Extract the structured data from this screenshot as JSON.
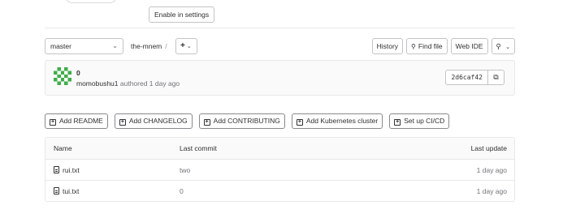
{
  "banner": {
    "enable_label": "Enable in settings"
  },
  "toolbar": {
    "branch": "master",
    "project": "the-mnem",
    "path_sep": "/",
    "add_label": "+",
    "history": "History",
    "find_file": "Find file",
    "web_ide": "Web IDE"
  },
  "commit": {
    "title": "0",
    "author": "momobushu1",
    "meta": "authored 1 day ago",
    "sha": "2d6caf42"
  },
  "actions": [
    {
      "label": "Add README"
    },
    {
      "label": "Add CHANGELOG"
    },
    {
      "label": "Add CONTRIBUTING"
    },
    {
      "label": "Add Kubernetes cluster"
    },
    {
      "label": "Set up CI/CD"
    }
  ],
  "files": {
    "headers": {
      "name": "Name",
      "last_commit": "Last commit",
      "last_update": "Last update"
    },
    "rows": [
      {
        "name": "rui.txt",
        "commit": "two",
        "update": "1 day ago"
      },
      {
        "name": "tui.txt",
        "commit": "0",
        "update": "1 day ago"
      }
    ]
  },
  "colors": {
    "avatar": "#3fae49",
    "border": "#c4c4c7"
  },
  "icons": [
    "chevron-down-icon",
    "search-icon",
    "fork-icon",
    "copy-icon",
    "plus-square-icon",
    "file-icon",
    "identicon-avatar"
  ]
}
